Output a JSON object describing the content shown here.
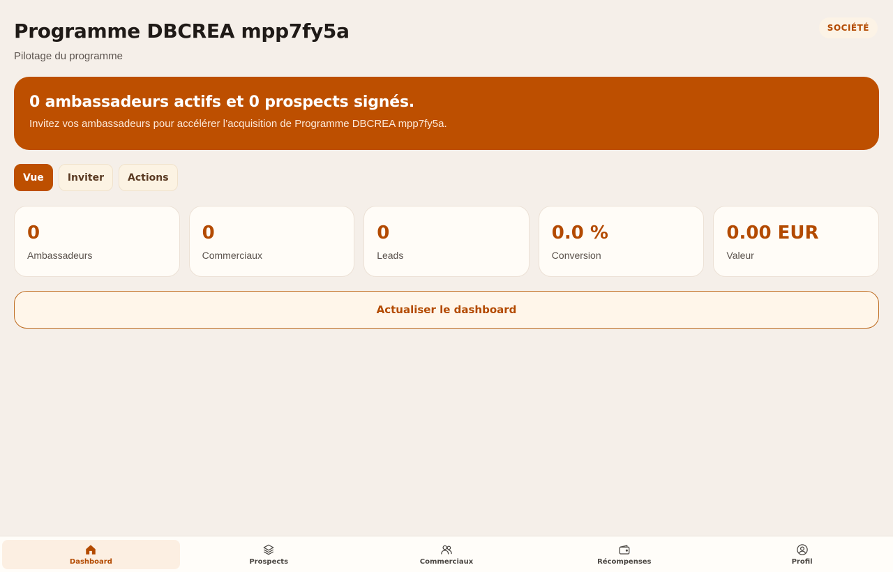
{
  "header": {
    "title": "Programme DBCREA mpp7fy5a",
    "subtitle": "Pilotage du programme",
    "role_badge": "SOCIÉTÉ"
  },
  "banner": {
    "title": "0 ambassadeurs actifs et 0 prospects signés.",
    "text": "Invitez vos ambassadeurs pour accélérer l’acquisition de Programme DBCREA mpp7fy5a."
  },
  "tabs": [
    {
      "label": "Vue",
      "active": true
    },
    {
      "label": "Inviter",
      "active": false
    },
    {
      "label": "Actions",
      "active": false
    }
  ],
  "stats": [
    {
      "value": "0",
      "label": "Ambassadeurs"
    },
    {
      "value": "0",
      "label": "Commerciaux"
    },
    {
      "value": "0",
      "label": "Leads"
    },
    {
      "value": "0.0 %",
      "label": "Conversion"
    },
    {
      "value": "0.00 EUR",
      "label": "Valeur"
    }
  ],
  "refresh_button": "Actualiser le dashboard",
  "bottom_nav": [
    {
      "label": "Dashboard",
      "icon": "home-icon",
      "active": true
    },
    {
      "label": "Prospects",
      "icon": "layers-icon",
      "active": false
    },
    {
      "label": "Commerciaux",
      "icon": "users-icon",
      "active": false
    },
    {
      "label": "Récompenses",
      "icon": "wallet-icon",
      "active": false
    },
    {
      "label": "Profil",
      "icon": "user-circle-icon",
      "active": false
    }
  ],
  "colors": {
    "accent": "#bd4f00",
    "background": "#f5efe9",
    "card": "#fffcf7"
  }
}
